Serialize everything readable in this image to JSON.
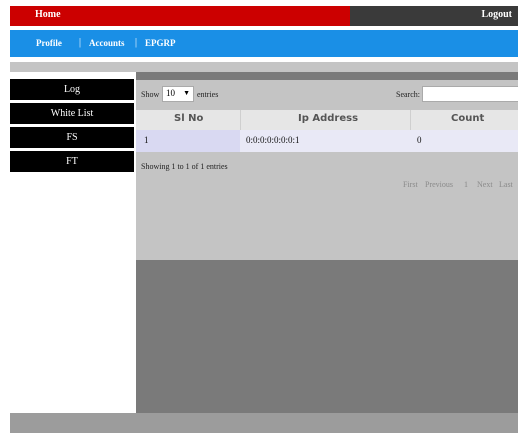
{
  "topbar": {
    "home": "Home",
    "logout": "Logout"
  },
  "nav": {
    "items": [
      "Profile",
      "Accounts",
      "EPGRP"
    ],
    "separator": "|"
  },
  "sidebar": {
    "items": [
      "Log",
      "White List",
      "FS",
      "FT"
    ]
  },
  "table_controls": {
    "show_label": "Show",
    "page_size": "10",
    "entries_label": "entries",
    "search_label": "Search:",
    "search_value": ""
  },
  "table": {
    "columns": [
      "Sl No",
      "Ip Address",
      "Count"
    ],
    "rows": [
      {
        "sl_no": "1",
        "ip_address": "0:0:0:0:0:0:0:1",
        "count": "0"
      }
    ]
  },
  "info": "Showing 1 to 1 of 1 entries",
  "pagination": {
    "first": "First",
    "previous": "Previous",
    "page": "1",
    "next": "Next",
    "last": "Last"
  },
  "colors": {
    "top_red": "#cc0000",
    "nav_blue": "#1a8fe6",
    "sidebar_black": "#000000",
    "main_grey": "#7a7a7a"
  }
}
